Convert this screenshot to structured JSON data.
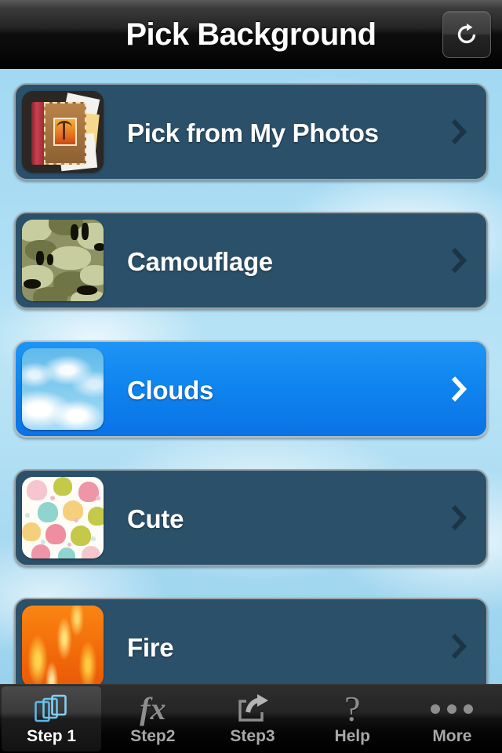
{
  "header": {
    "title": "Pick Background",
    "refresh_icon": "refresh-icon"
  },
  "list": {
    "rows": [
      {
        "label": "Pick from My Photos",
        "thumb": "photo-album-icon",
        "selected": false,
        "chevron": "chevron-right-icon"
      },
      {
        "label": "Camouflage",
        "thumb": "camouflage-swatch",
        "selected": false,
        "chevron": "chevron-right-icon"
      },
      {
        "label": "Clouds",
        "thumb": "clouds-swatch",
        "selected": true,
        "chevron": "chevron-right-icon"
      },
      {
        "label": "Cute",
        "thumb": "cute-swatch",
        "selected": false,
        "chevron": "chevron-right-icon"
      },
      {
        "label": "Fire",
        "thumb": "fire-swatch",
        "selected": false,
        "chevron": "chevron-right-icon"
      }
    ]
  },
  "tabbar": {
    "items": [
      {
        "label": "Step 1",
        "icon": "layers-icon",
        "active": true
      },
      {
        "label": "Step2",
        "icon": "fx-icon",
        "active": false
      },
      {
        "label": "Step3",
        "icon": "share-icon",
        "active": false
      },
      {
        "label": "Help",
        "icon": "question-mark-icon",
        "active": false
      },
      {
        "label": "More",
        "icon": "ellipsis-icon",
        "active": false
      }
    ]
  },
  "colors": {
    "row_background": "#2b5069",
    "row_selected": "#0f85ef",
    "sky": "#a9dcf3",
    "chevron": "#1b3547",
    "chevron_selected": "#ffffff",
    "tab_active_text": "#ffffff",
    "tab_text": "#a8a8a8",
    "layers_icon_accent": "#5bb8e8"
  }
}
